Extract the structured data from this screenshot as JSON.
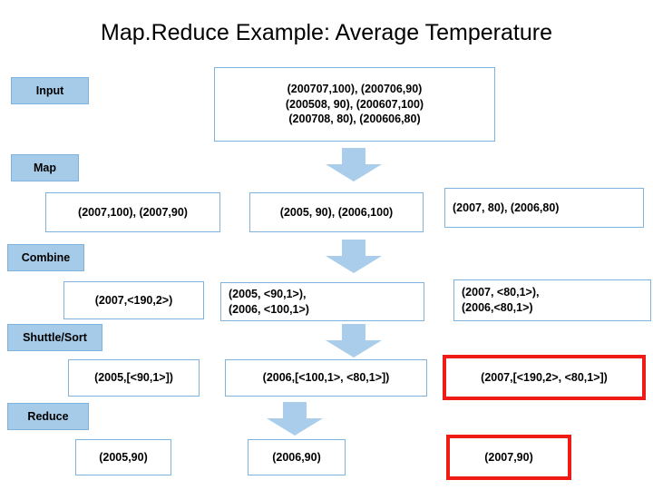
{
  "title": "Map.Reduce Example: Average Temperature",
  "colors": {
    "stage_fill": "#a6cbe8",
    "box_border": "#7fb2dc",
    "arrow_fill": "#a9cdeb",
    "highlight": "#ee1c15",
    "text": "#000000"
  },
  "stages": [
    {
      "label": "Input"
    },
    {
      "label": "Map"
    },
    {
      "label": "Combine"
    },
    {
      "label": "Shuttle/Sort"
    },
    {
      "label": "Reduce"
    }
  ],
  "input_box": {
    "lines": [
      "(200707,100), (200706,90)",
      "(200508, 90), (200607,100)",
      "(200708, 80), (200606,80)"
    ]
  },
  "map_row": [
    {
      "lines": [
        "(2007,100), (2007,90)"
      ]
    },
    {
      "lines": [
        "(2005, 90), (2006,100)"
      ]
    },
    {
      "lines": [
        "(2007, 80), (2006,80)"
      ]
    }
  ],
  "combine_row": [
    {
      "lines": [
        "(2007,<190,2>)"
      ]
    },
    {
      "lines": [
        "(2005, <90,1>),",
        "(2006, <100,1>)"
      ]
    },
    {
      "lines": [
        "(2007, <80,1>),",
        "(2006,<80,1>)"
      ]
    }
  ],
  "shuffle_row": [
    {
      "lines": [
        "(2005,[<90,1>])"
      ]
    },
    {
      "lines": [
        "(2006,[<100,1>, <80,1>])"
      ]
    },
    {
      "lines": [
        "(2007,[<190,2>, <80,1>])"
      ],
      "highlighted": true
    }
  ],
  "reduce_row": [
    {
      "lines": [
        "(2005,90)"
      ]
    },
    {
      "lines": [
        "(2006,90)"
      ]
    },
    {
      "lines": [
        "(2007,90)"
      ],
      "highlighted": true
    }
  ]
}
